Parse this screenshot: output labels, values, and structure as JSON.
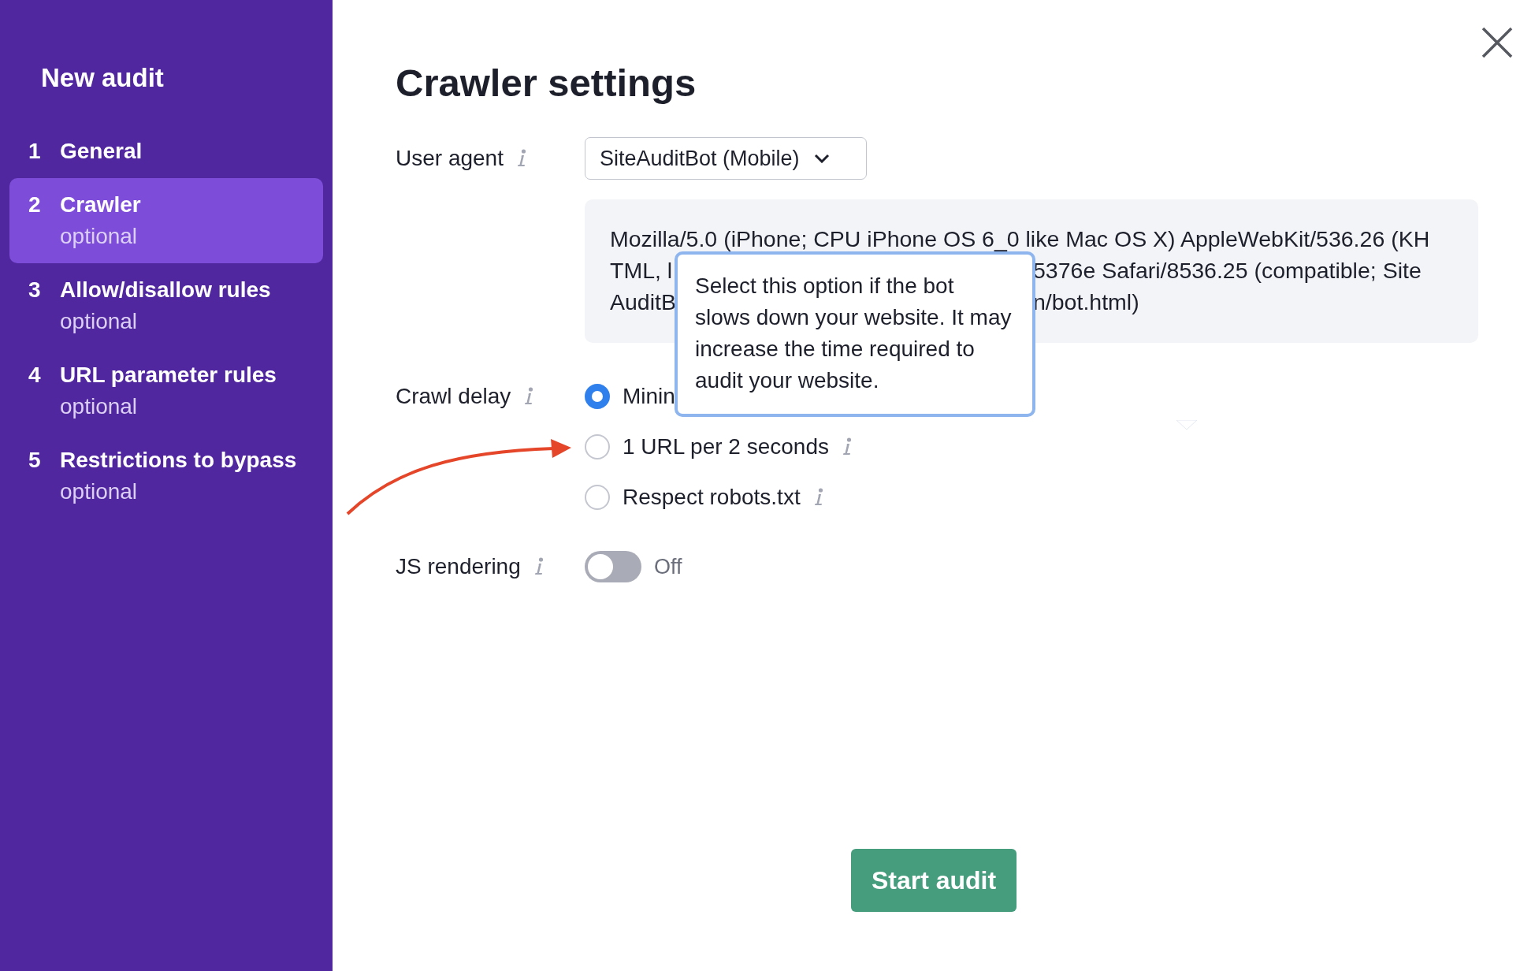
{
  "sidebar": {
    "title": "New audit",
    "steps": [
      {
        "number": "1",
        "label": "General",
        "selected": false
      },
      {
        "number": "2",
        "label": "Crawler",
        "sublabel": "optional",
        "selected": true
      },
      {
        "number": "3",
        "label": "Allow/disallow rules",
        "sublabel": "optional",
        "selected": false
      },
      {
        "number": "4",
        "label": "URL parameter rules",
        "sublabel": "optional",
        "selected": false
      },
      {
        "number": "5",
        "label": "Restrictions to bypass",
        "sublabel": "optional",
        "selected": false
      }
    ]
  },
  "title": "Crawler settings",
  "settings": [
    {
      "kind": "select",
      "label": "User agent",
      "value": "SiteAuditBot (Mobile)",
      "description_lines": [
        {
          "left": "Mozilla/5.0 (iPhone; CPU iPhone OS 6_0 like Mac OS X) AppleWebKit/536.26 (KH"
        },
        {
          "left": "TML, l",
          "right": "5376e Safari/8536.25 (compatible; Site"
        },
        {
          "left": "AuditB",
          "right": "n/bot.html)"
        }
      ]
    },
    {
      "kind": "radio",
      "label": "Crawl delay",
      "options": [
        {
          "label": "Minin",
          "selected": true,
          "info": false
        },
        {
          "label": "1 URL per 2 seconds",
          "selected": false,
          "info": true
        },
        {
          "label": "Respect robots.txt",
          "selected": false,
          "info": true
        }
      ]
    },
    {
      "kind": "toggle",
      "label": "JS rendering",
      "on": false,
      "state_text": "Off"
    }
  ],
  "tooltip": {
    "text": "Select this option if the bot slows down your website. It may increase the time required to audit your website."
  },
  "primary_button": "Start audit"
}
